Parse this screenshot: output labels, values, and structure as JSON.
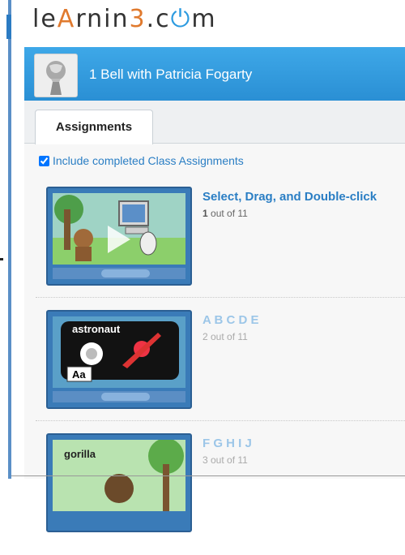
{
  "logo": {
    "p1": "le",
    "p2": "A",
    "p3": "rnin",
    "p4": "3",
    "p5": ".c",
    "p6": "⏻",
    "p7": "m"
  },
  "user": {
    "name": "1 Bell with Patricia Fogarty"
  },
  "tabs": [
    {
      "label": "Assignments"
    }
  ],
  "include_completed": {
    "label": "Include completed Class Assignments",
    "checked": true
  },
  "assignments": [
    {
      "title": "Select, Drag, and Double-click",
      "progress_num": "1",
      "progress_rest": " out of 11",
      "active": true,
      "thumb_text": "",
      "colors": {
        "title": "#2a7ec4"
      }
    },
    {
      "title": "A B C D E",
      "progress_num": "",
      "progress_rest": "2 out of 11",
      "active": false,
      "thumb_text": "astronaut",
      "thumb_tag": "Aa",
      "colors": {
        "title": "#9cc6e8"
      }
    },
    {
      "title": "F G H I J",
      "progress_num": "",
      "progress_rest": "3 out of 11",
      "active": false,
      "thumb_text": "gorilla",
      "colors": {
        "title": "#9cc6e8"
      }
    }
  ],
  "colors": {
    "accent": "#2a8fd4",
    "link": "#2a7ec4"
  }
}
